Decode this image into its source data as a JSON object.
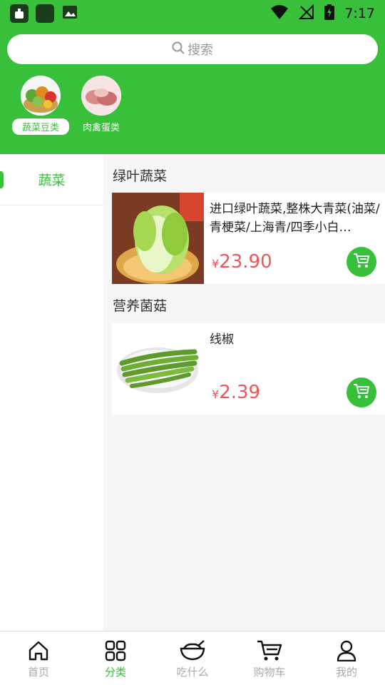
{
  "status_bar": {
    "time": "7:17"
  },
  "search": {
    "placeholder": "搜索"
  },
  "categories": [
    {
      "label": "蔬菜豆类",
      "active": true
    },
    {
      "label": "肉禽蛋类",
      "active": false
    }
  ],
  "sidebar": {
    "items": [
      {
        "label": "蔬菜",
        "active": true
      }
    ]
  },
  "sections": [
    {
      "title": "绿叶蔬菜",
      "products": [
        {
          "name": "进口绿叶蔬菜,整株大青菜(油菜/青梗菜/上海青/四季小白…",
          "currency": "¥",
          "price": "23.90"
        }
      ]
    },
    {
      "title": "营养菌菇",
      "products": [
        {
          "name": "线椒",
          "currency": "¥",
          "price": "2.39"
        }
      ]
    }
  ],
  "bottom_nav": [
    {
      "label": "首页",
      "icon": "home-icon",
      "active": false
    },
    {
      "label": "分类",
      "icon": "grid-icon",
      "active": true
    },
    {
      "label": "吃什么",
      "icon": "bowl-icon",
      "active": false
    },
    {
      "label": "购物车",
      "icon": "cart-icon",
      "active": false
    },
    {
      "label": "我的",
      "icon": "user-icon",
      "active": false
    }
  ],
  "colors": {
    "brand_green": "#38c03b",
    "price_red": "#f0555a"
  }
}
